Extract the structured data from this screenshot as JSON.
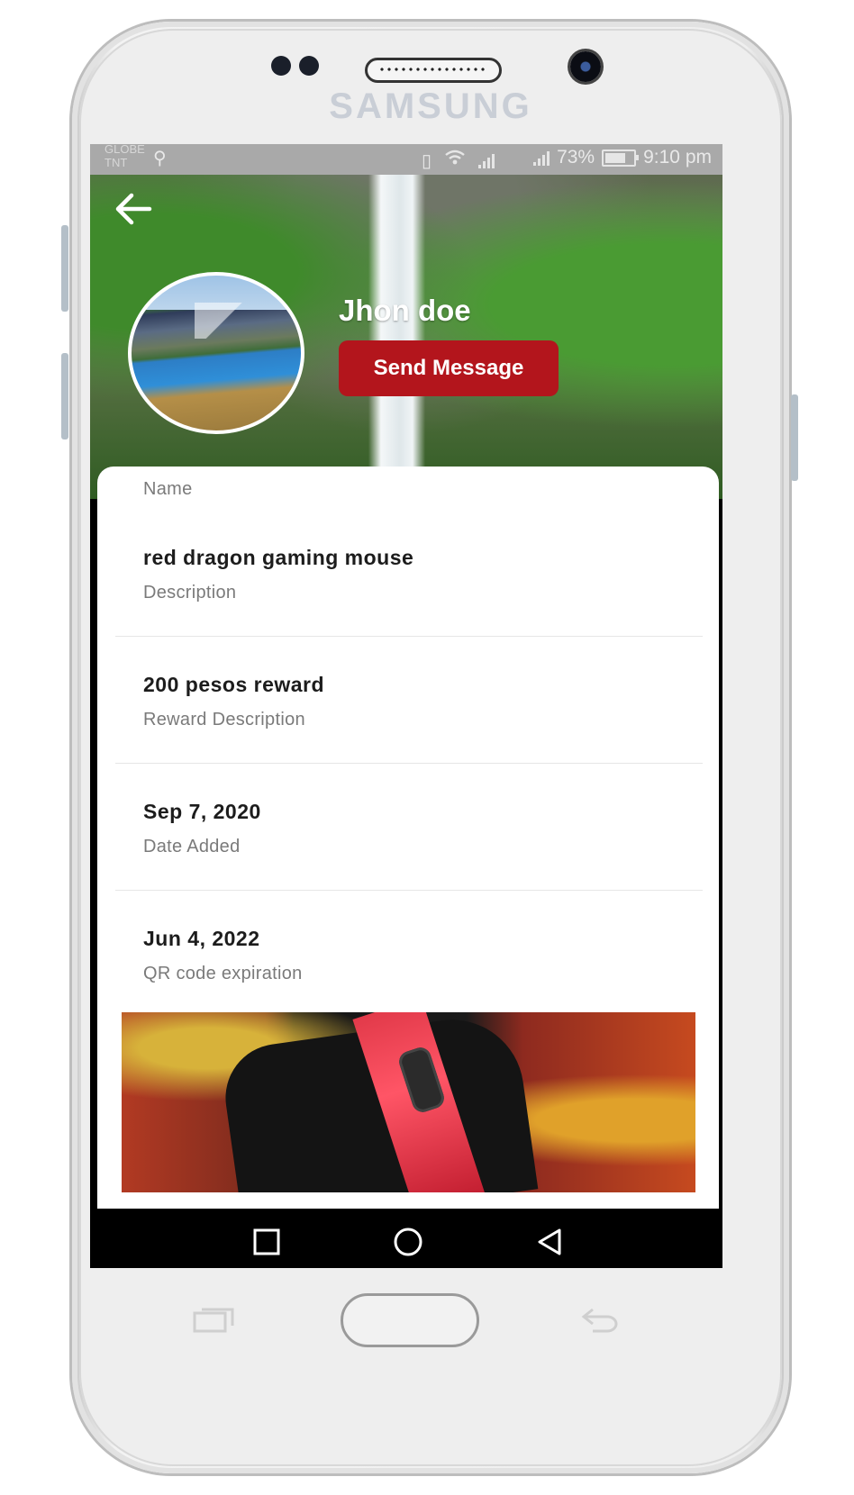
{
  "device": {
    "brand": "SAMSUNG"
  },
  "statusbar": {
    "carrier_line1": "GLOBE",
    "carrier_line2": "TNT",
    "battery": "73%",
    "time": "9:10 pm"
  },
  "profile": {
    "name": "Jhon doe",
    "send_message_label": "Send Message"
  },
  "details": {
    "top_label": "Name",
    "items": [
      {
        "value": "red dragon gaming mouse",
        "label": "Description"
      },
      {
        "value": "200 pesos reward",
        "label": "Reward Description"
      },
      {
        "value": "Sep 7, 2020",
        "label": "Date Added"
      },
      {
        "value": "Jun 4, 2022",
        "label": "QR code expiration"
      }
    ]
  },
  "icons": {
    "back": "arrow-left-icon",
    "recents": "square-icon",
    "home": "circle-icon",
    "back_nav": "triangle-back-icon"
  },
  "colors": {
    "accent": "#b3151c",
    "card": "#ffffff",
    "navbar": "#000000"
  }
}
